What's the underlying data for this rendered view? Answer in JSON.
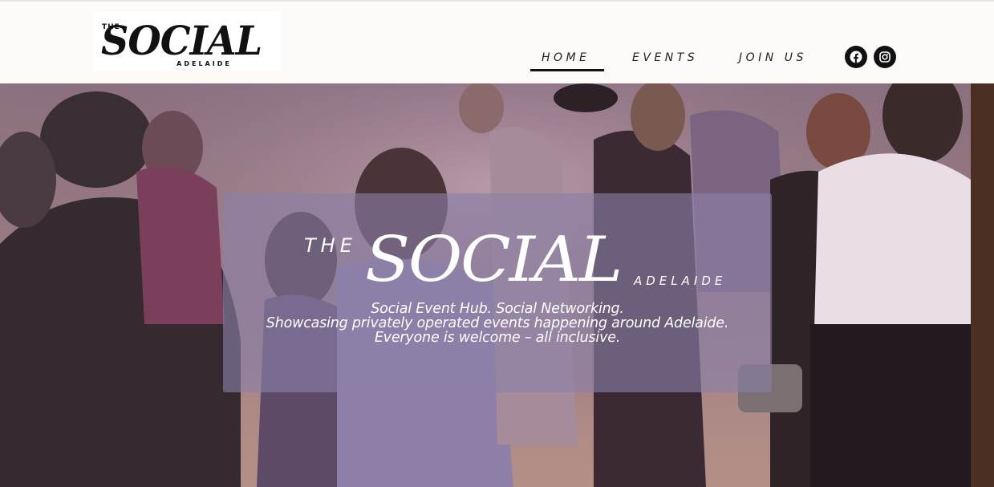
{
  "header": {
    "logo": {
      "the": "THE",
      "word": "SOCIAL",
      "sub": "ADELAIDE"
    },
    "nav": [
      {
        "label": "HOME",
        "active": true
      },
      {
        "label": "EVENTS",
        "active": false
      },
      {
        "label": "JOIN US",
        "active": false
      }
    ],
    "social": [
      {
        "icon": "facebook-icon"
      },
      {
        "icon": "instagram-icon"
      }
    ]
  },
  "hero": {
    "the": "THE",
    "social": "SOCIAL",
    "adelaide": "ADELAIDE",
    "lines": [
      "Social Event Hub. Social Networking.",
      "Showcasing privately operated events happening around Adelaide.",
      "Everyone is welcome – all inclusive."
    ]
  },
  "colors": {
    "header_bg": "#fdfaf7",
    "accent": "#111111",
    "overlay": "#8a80a8"
  }
}
